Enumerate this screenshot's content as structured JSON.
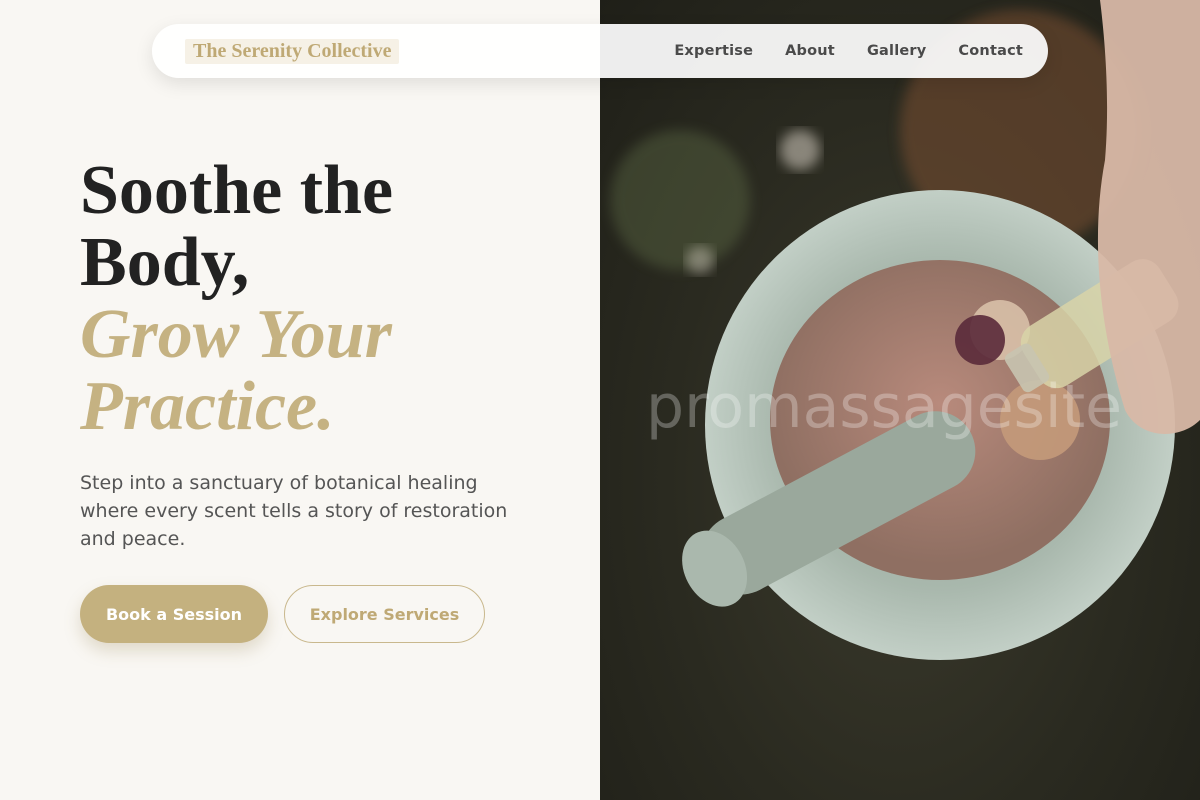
{
  "brand": {
    "name": "The Serenity Collective"
  },
  "nav": {
    "items": [
      "Expertise",
      "About",
      "Gallery",
      "Contact"
    ]
  },
  "hero": {
    "headline_line1": "Soothe the Body,",
    "headline_accent": "Grow Your Practice.",
    "subtext": "Step into a sanctuary of botanical healing where every scent tells a story of restoration and peace.",
    "primary_cta": "Book a Session",
    "secondary_cta": "Explore Services"
  },
  "image": {
    "watermark": "promassagesite"
  },
  "colors": {
    "accent": "#c4b17f",
    "background": "#f9f7f3",
    "text": "#222222"
  }
}
